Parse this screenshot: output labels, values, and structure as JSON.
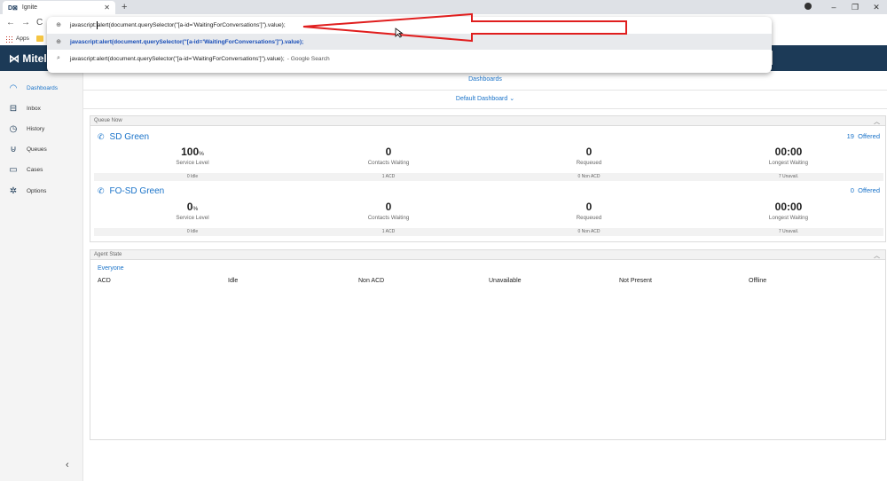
{
  "browser": {
    "tab_title": "Ignite",
    "tab_favicon": "D⊠",
    "bookmarks_apps": "Apps",
    "omnibox": {
      "typed_prefix": "javascript:",
      "typed_rest": "alert(document.querySelector(\"[a-id='WaitingForConversations']\").value);",
      "suggestion_1": "javascript:alert(document.querySelector(\"[a-id='WaitingForConversations']\").value);",
      "suggestion_2": "javascript:alert(document.querySelector(\"[a-id='WaitingForConversations']\").value);",
      "suggestion_2_suffix": "- Google Search"
    }
  },
  "app": {
    "logo": "Mitel",
    "brand_color": "#1c3a57",
    "accent_color": "#1a73c9"
  },
  "sidebar": {
    "items": [
      {
        "label": "Dashboards",
        "icon": "dashboard-gauge-icon"
      },
      {
        "label": "Inbox",
        "icon": "inbox-icon"
      },
      {
        "label": "History",
        "icon": "clock-icon"
      },
      {
        "label": "Queues",
        "icon": "queues-icon"
      },
      {
        "label": "Cases",
        "icon": "folder-icon"
      },
      {
        "label": "Options",
        "icon": "gear-icon"
      }
    ]
  },
  "main": {
    "dashboards_link": "Dashboards",
    "dashboard_select": "Default Dashboard"
  },
  "queue_now": {
    "title": "Queue Now",
    "queues": [
      {
        "name": "SD Green",
        "offered_count": "19",
        "offered_label": "Offered",
        "stats": [
          {
            "value": "100",
            "unit": "%",
            "label": "Service Level"
          },
          {
            "value": "0",
            "unit": "",
            "label": "Contacts Waiting"
          },
          {
            "value": "0",
            "unit": "",
            "label": "Requeued"
          },
          {
            "value": "00:00",
            "unit": "",
            "label": "Longest Waiting"
          }
        ],
        "sub": [
          "0 Idle",
          "1 ACD",
          "0 Non ACD",
          "7 Unavail."
        ]
      },
      {
        "name": "FO-SD Green",
        "offered_count": "0",
        "offered_label": "Offered",
        "stats": [
          {
            "value": "0",
            "unit": "%",
            "label": "Service Level"
          },
          {
            "value": "0",
            "unit": "",
            "label": "Contacts Waiting"
          },
          {
            "value": "0",
            "unit": "",
            "label": "Requeued"
          },
          {
            "value": "00:00",
            "unit": "",
            "label": "Longest Waiting"
          }
        ],
        "sub": [
          "0 Idle",
          "1 ACD",
          "0 Non ACD",
          "7 Unavail."
        ]
      }
    ]
  },
  "agent_state": {
    "title": "Agent State",
    "group": "Everyone",
    "columns": [
      "ACD",
      "Idle",
      "Non ACD",
      "Unavailable",
      "Not Present",
      "Offline"
    ]
  }
}
